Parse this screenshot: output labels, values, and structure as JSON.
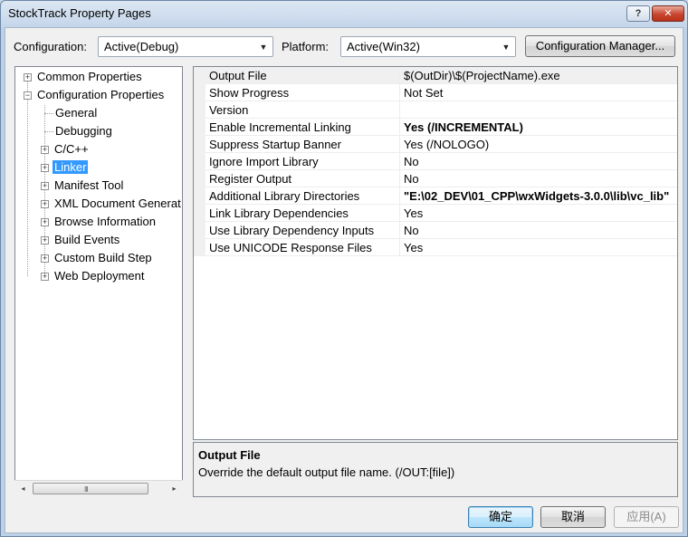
{
  "window": {
    "title": "StockTrack Property Pages",
    "help_label": "?",
    "close_label": "✕"
  },
  "config_bar": {
    "configuration_label": "Configuration:",
    "configuration_value": "Active(Debug)",
    "platform_label": "Platform:",
    "platform_value": "Active(Win32)",
    "manager_button": "Configuration Manager..."
  },
  "tree": {
    "items": [
      {
        "label": "Common Properties",
        "expander": "+"
      },
      {
        "label": "Configuration Properties",
        "expander": "−"
      },
      {
        "label": "General"
      },
      {
        "label": "Debugging"
      },
      {
        "label": "C/C++",
        "expander": "+"
      },
      {
        "label": "Linker",
        "expander": "+",
        "selected": true
      },
      {
        "label": "Manifest Tool",
        "expander": "+"
      },
      {
        "label": "XML Document Generat",
        "expander": "+"
      },
      {
        "label": "Browse Information",
        "expander": "+"
      },
      {
        "label": "Build Events",
        "expander": "+"
      },
      {
        "label": "Custom Build Step",
        "expander": "+"
      },
      {
        "label": "Web Deployment",
        "expander": "+"
      }
    ],
    "scroll_left": "◂",
    "scroll_right": "▸",
    "scroll_grip": "III"
  },
  "grid": {
    "rows": [
      {
        "name": "Output File",
        "value": "$(OutDir)\\$(ProjectName).exe"
      },
      {
        "name": "Show Progress",
        "value": "Not Set"
      },
      {
        "name": "Version",
        "value": ""
      },
      {
        "name": "Enable Incremental Linking",
        "value": "Yes (/INCREMENTAL)",
        "bold": true
      },
      {
        "name": "Suppress Startup Banner",
        "value": "Yes (/NOLOGO)"
      },
      {
        "name": "Ignore Import Library",
        "value": "No"
      },
      {
        "name": "Register Output",
        "value": "No"
      },
      {
        "name": "Additional Library Directories",
        "value": "\"E:\\02_DEV\\01_CPP\\wxWidgets-3.0.0\\lib\\vc_lib\"",
        "bold": true
      },
      {
        "name": "Link Library Dependencies",
        "value": "Yes"
      },
      {
        "name": "Use Library Dependency Inputs",
        "value": "No"
      },
      {
        "name": "Use UNICODE Response Files",
        "value": "Yes"
      }
    ]
  },
  "description": {
    "title": "Output File",
    "text": "Override the default output file name.     (/OUT:[file])"
  },
  "buttons": {
    "ok": "确定",
    "cancel": "取消",
    "apply": "应用(A)"
  }
}
